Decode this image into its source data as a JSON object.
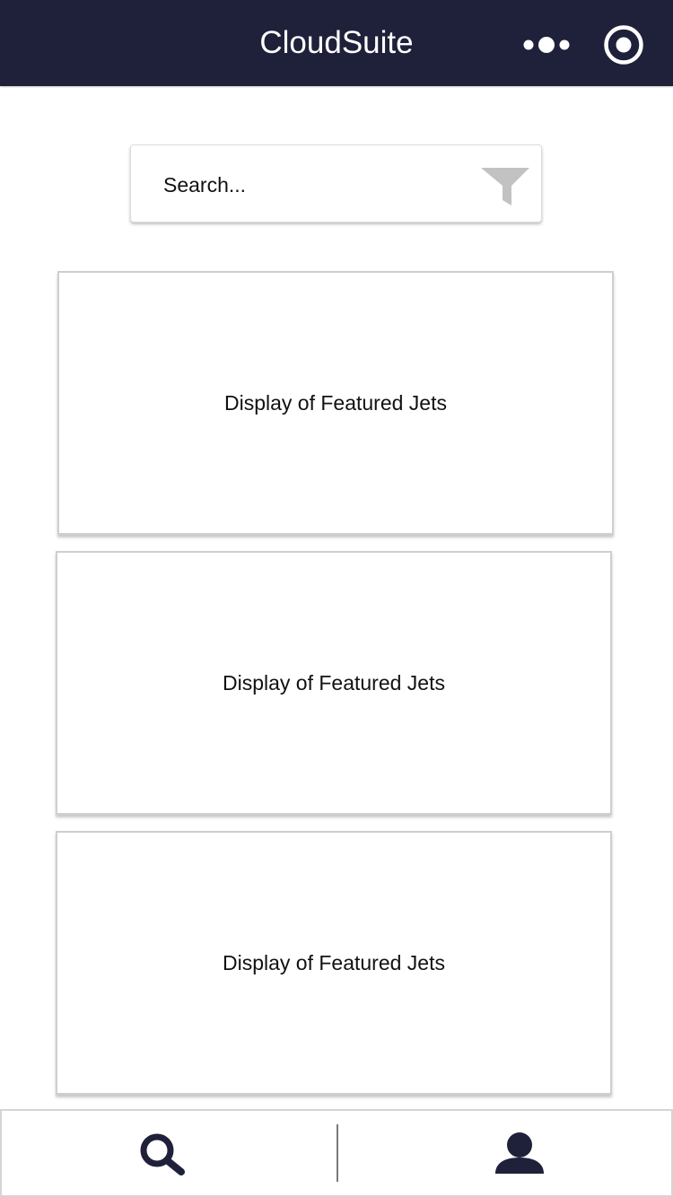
{
  "header": {
    "title": "CloudSuite",
    "more_icon": "more-dots-icon",
    "target_icon": "target-icon",
    "background_color": "#1f2039"
  },
  "search": {
    "placeholder": "Search...",
    "value": "",
    "filter_icon": "filter-icon"
  },
  "cards": [
    {
      "label": "Display of Featured Jets"
    },
    {
      "label": "Display of Featured Jets"
    },
    {
      "label": "Display of Featured Jets"
    }
  ],
  "bottom_nav": {
    "items": [
      {
        "icon": "search-icon"
      },
      {
        "icon": "profile-icon"
      }
    ],
    "icon_color": "#1f2039"
  }
}
